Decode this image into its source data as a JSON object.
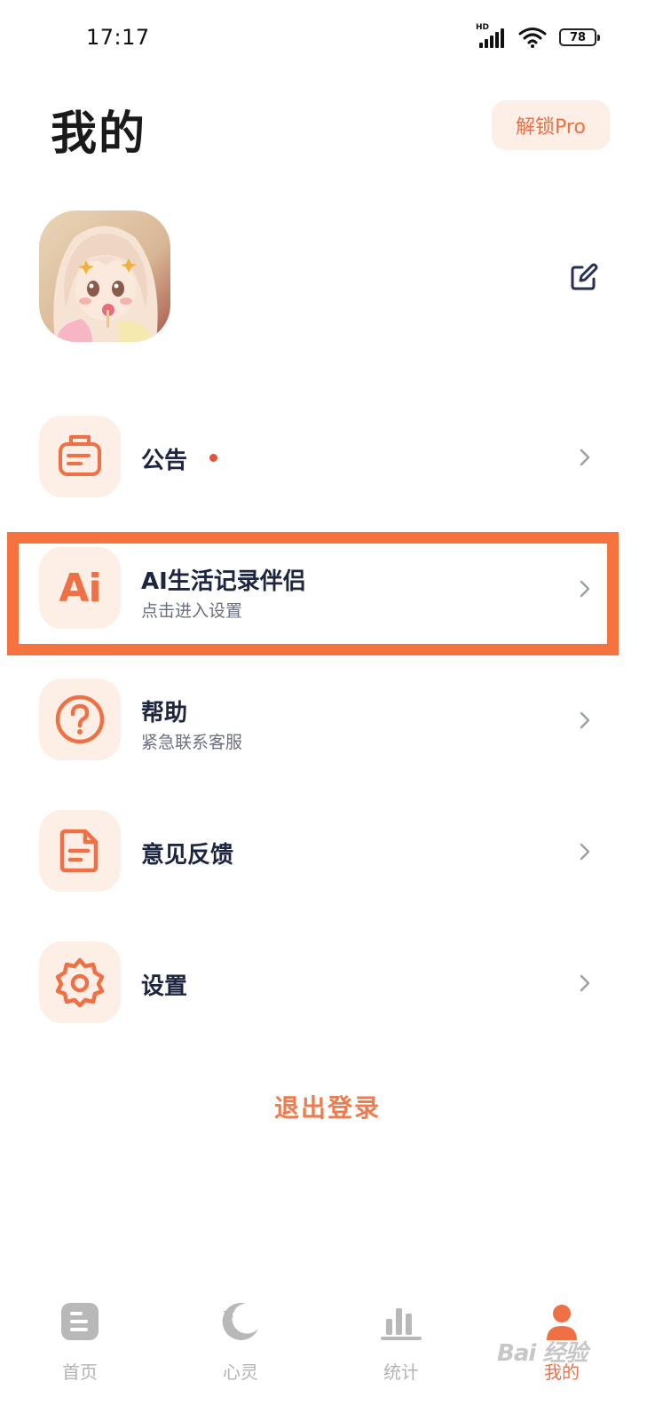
{
  "status_bar": {
    "time": "17:17",
    "battery": "78",
    "network": "HD"
  },
  "header": {
    "title": "我的",
    "pro_button": "解锁Pro"
  },
  "menu": [
    {
      "title": "公告",
      "subtitle": "",
      "icon": "announcement-icon",
      "has_dot": true
    },
    {
      "title": "AI生活记录伴侣",
      "subtitle": "点击进入设置",
      "icon": "ai-icon",
      "icon_text": "Ai"
    },
    {
      "title": "帮助",
      "subtitle": "紧急联系客服",
      "icon": "help-icon"
    },
    {
      "title": "意见反馈",
      "subtitle": "",
      "icon": "feedback-icon"
    },
    {
      "title": "设置",
      "subtitle": "",
      "icon": "settings-icon"
    }
  ],
  "logout_label": "退出登录",
  "tabs": [
    {
      "label": "首页",
      "icon": "home-icon",
      "active": false
    },
    {
      "label": "心灵",
      "icon": "moon-icon",
      "active": false
    },
    {
      "label": "统计",
      "icon": "chart-icon",
      "active": false
    },
    {
      "label": "我的",
      "icon": "profile-icon",
      "active": true
    }
  ],
  "watermark": "Bai 经验",
  "colors": {
    "accent": "#f07046",
    "accent_light": "#fdeee6",
    "highlight": "#f5733e",
    "text": "#1d2540",
    "inactive": "#b3b3b3"
  }
}
